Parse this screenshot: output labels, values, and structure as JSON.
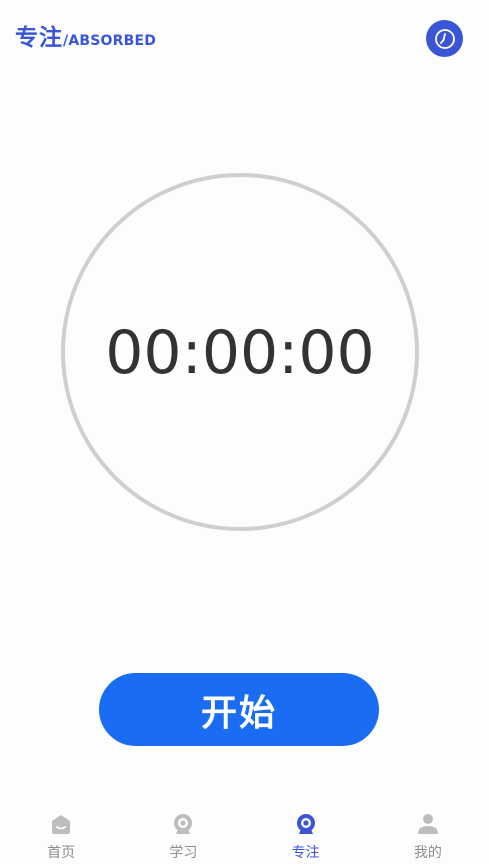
{
  "header": {
    "title_cn": "专注",
    "title_en": "/ABSORBED"
  },
  "icons": {
    "history": "clock-icon",
    "home": "home-icon",
    "study": "camera-icon",
    "focus": "camera-icon",
    "mine": "person-icon"
  },
  "timer": {
    "display": "00:00:00"
  },
  "start_button": {
    "label": "开始"
  },
  "tabbar": {
    "tabs": [
      {
        "label": "首页",
        "active": false
      },
      {
        "label": "学习",
        "active": false
      },
      {
        "label": "专注",
        "active": true
      },
      {
        "label": "我的",
        "active": false
      }
    ]
  },
  "colors": {
    "accent": "#3a56d6",
    "button": "#1a6df2",
    "ring": "#cfcfcf",
    "inactive": "#bdbdbd"
  }
}
